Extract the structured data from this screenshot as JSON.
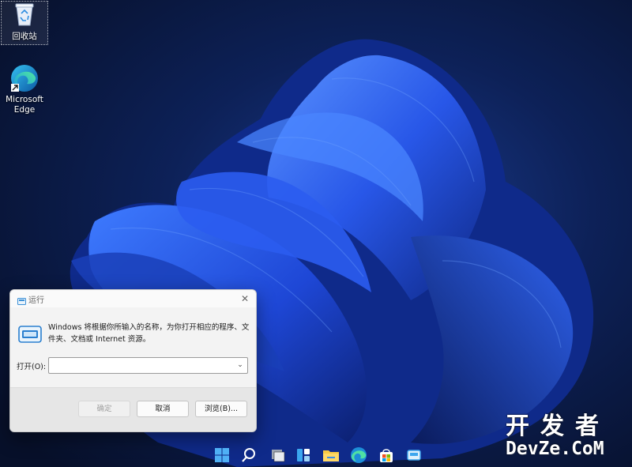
{
  "desktop": {
    "icons": [
      {
        "label": "回收站",
        "icon": "recycle-bin-icon"
      },
      {
        "label": "Microsoft Edge",
        "icon": "edge-icon"
      }
    ]
  },
  "run_dialog": {
    "title": "运行",
    "description": "Windows 将根据你所输入的名称，为你打开相应的程序、文件夹、文档或 Internet 资源。",
    "open_label": "打开(O):",
    "input_value": "",
    "ok_label": "确定",
    "cancel_label": "取消",
    "browse_label": "浏览(B)...",
    "close_glyph": "✕",
    "dropdown_glyph": "⌄"
  },
  "taskbar": {
    "icons": [
      "start-icon",
      "search-icon",
      "task-view-icon",
      "widgets-icon",
      "file-explorer-icon",
      "edge-icon",
      "store-icon",
      "run-app-icon"
    ]
  },
  "watermark": {
    "cn": "开发者",
    "en": "DevZe.CoM"
  },
  "colors": {
    "wallpaper_bg": "#0a1430",
    "bloom_blue": "#1f4fe0",
    "dialog_bg": "#f3f3f3"
  }
}
